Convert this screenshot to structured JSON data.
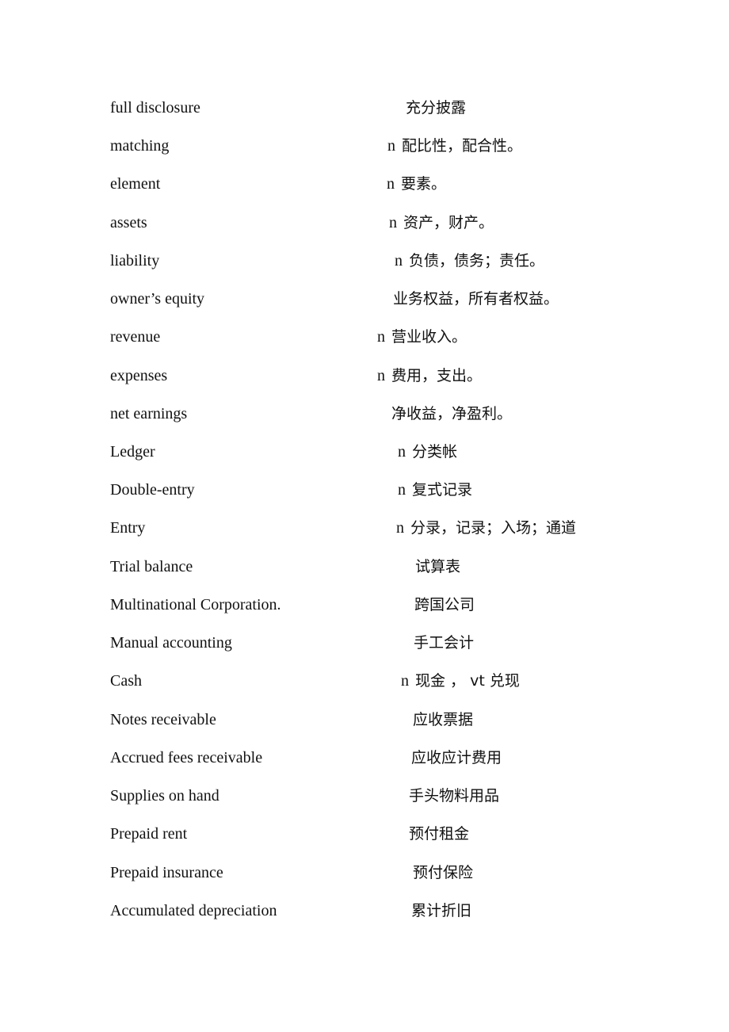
{
  "document": {
    "entries": [
      {
        "term": "full disclosure",
        "pos": "",
        "translation": "充分披露"
      },
      {
        "term": "matching",
        "pos": "n",
        "translation": "配比性，配合性。"
      },
      {
        "term": "element",
        "pos": "n",
        "translation": "要素。"
      },
      {
        "term": "assets",
        "pos": "n",
        "translation": "资产，财产。"
      },
      {
        "term": "liability",
        "pos": "n",
        "translation": "负债，债务；责任。"
      },
      {
        "term": "owner’s equity",
        "pos": "",
        "translation": "业务权益，所有者权益。"
      },
      {
        "term": "revenue",
        "pos": "n",
        "translation": "营业收入。"
      },
      {
        "term": "expenses",
        "pos": "n",
        "translation": "费用，支出。"
      },
      {
        "term": "net earnings",
        "pos": "",
        "translation": "净收益，净盈利。"
      },
      {
        "term": "Ledger",
        "pos": "n",
        "translation": "分类帐"
      },
      {
        "term": "Double-entry",
        "pos": "n",
        "translation": "复式记录"
      },
      {
        "term": "Entry",
        "pos": "n",
        "translation": "分录，记录；入场；通道"
      },
      {
        "term": "Trial balance",
        "pos": "",
        "translation": "试算表"
      },
      {
        "term": "Multinational Corporation.",
        "pos": "",
        "translation": "跨国公司"
      },
      {
        "term": "Manual accounting",
        "pos": "",
        "translation": "手工会计"
      },
      {
        "term": "Cash",
        "pos": "n",
        "translation": "现金 ，  vt 兑现"
      },
      {
        "term": "Notes receivable",
        "pos": "",
        "translation": "应收票据"
      },
      {
        "term": "Accrued fees receivable",
        "pos": "",
        "translation": "应收应计费用"
      },
      {
        "term": "Supplies on hand",
        "pos": "",
        "translation": "手头物料用品"
      },
      {
        "term": "Prepaid rent",
        "pos": "",
        "translation": "预付租金"
      },
      {
        "term": "Prepaid insurance",
        "pos": "",
        "translation": "预付保险"
      },
      {
        "term": "Accumulated depreciation",
        "pos": "",
        "translation": "累计折旧"
      }
    ]
  }
}
